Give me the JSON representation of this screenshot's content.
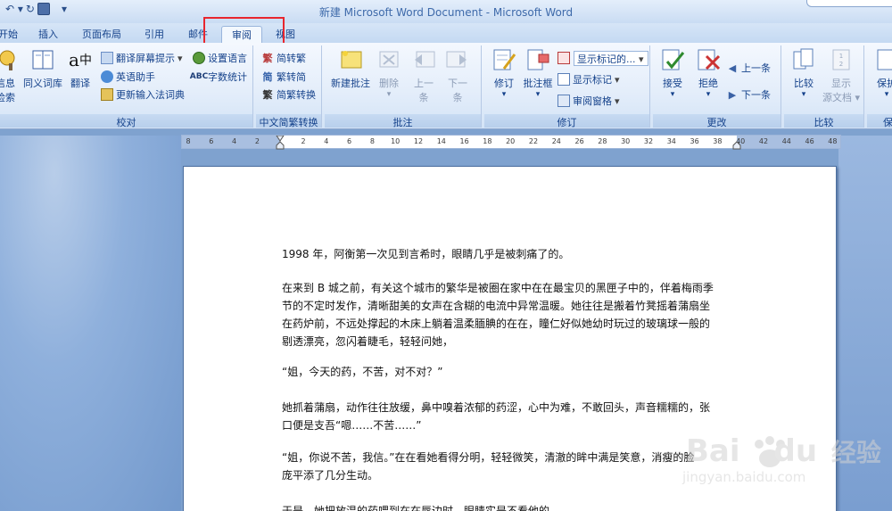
{
  "window": {
    "title": "新建 Microsoft Word Document - Microsoft Word"
  },
  "quick_access": {
    "undo_glyph": "↶ ▾",
    "redo_glyph": "↻",
    "more_glyph": "▾"
  },
  "tabs": [
    {
      "label": "开始"
    },
    {
      "label": "插入"
    },
    {
      "label": "页面布局"
    },
    {
      "label": "引用"
    },
    {
      "label": "邮件"
    },
    {
      "label": "审阅"
    },
    {
      "label": "视图"
    }
  ],
  "ribbon": {
    "proofing": {
      "label": "校对",
      "research_line1": "信息",
      "research_line2": "检索",
      "thesaurus": "同义词库",
      "translate": "翻译",
      "translate_tip": "翻译屏幕提示",
      "english_assistant": "英语助手",
      "update_ime": "更新输入法词典",
      "set_language": "设置语言",
      "word_count": "字数统计"
    },
    "chinese_conversion": {
      "label": "中文简繁转换",
      "to_traditional": "简转繁",
      "to_simplified": "繁转简",
      "convert": "简繁转换"
    },
    "comments": {
      "label": "批注",
      "new_comment": "新建批注",
      "delete": "删除",
      "prev_line1": "上一",
      "prev_line2": "条",
      "next_line1": "下一",
      "next_line2": "条"
    },
    "tracking": {
      "label": "修订",
      "track_changes": "修订",
      "balloons": "批注框",
      "display_markup": "显示标记的...",
      "show_markup": "显示标记",
      "reviewing_pane": "审阅窗格"
    },
    "changes": {
      "label": "更改",
      "accept": "接受",
      "reject": "拒绝",
      "previous": "上一条",
      "next": "下一条"
    },
    "compare": {
      "label": "比较",
      "compare": "比较",
      "show_source_line1": "显示",
      "show_source_line2": "源文档"
    },
    "protect": {
      "label": "保",
      "protect": "保护"
    }
  },
  "ruler": {
    "numbers": [
      "8",
      "6",
      "4",
      "2",
      "2",
      "4",
      "6",
      "8",
      "10",
      "12",
      "14",
      "16",
      "18",
      "20",
      "22",
      "24",
      "26",
      "28",
      "30",
      "32",
      "34",
      "36",
      "38",
      "40",
      "42",
      "44",
      "46",
      "48"
    ]
  },
  "document": {
    "paragraphs": [
      [
        "1998 年，阿衡第一次见到言希时，眼睛几乎是被刺痛了的。"
      ],
      [
        "在来到 B 城之前，有关这个城市的繁华是被圈在家中在在最宝贝的黑匣子中的，伴着梅雨季",
        "节的不定时发作，清晰甜美的女声在含糊的电流中异常温暖。她往往是搬着竹凳摇着蒲扇坐",
        "在药炉前，不远处撑起的木床上躺着温柔腼腆的在在，瞳仁好似她幼时玩过的玻璃球一般的",
        "剔透漂亮，忽闪着睫毛，轻轻问她，"
      ],
      [
        "“姐，今天的药，不苦，对不对？”"
      ],
      [
        "她抓着蒲扇，动作往往放缓，鼻中嗅着浓郁的药涩，心中为难，不敢回头，声音糯糯的，张",
        "口便是支吾“嗯……不苦……”"
      ],
      [
        "“姐，你说不苦，我信。”在在看她看得分明，轻轻微笑，清澈的眸中满是笑意，消瘦的脸",
        "庞平添了几分生动。"
      ],
      [
        "于是，她把放温的药喂到在在唇边时，眼睛实是不看他的。"
      ]
    ]
  },
  "watermark": {
    "brand": "Bai",
    "brand2": "du",
    "jingyan": "经验",
    "url": "jingyan.baidu.com"
  }
}
